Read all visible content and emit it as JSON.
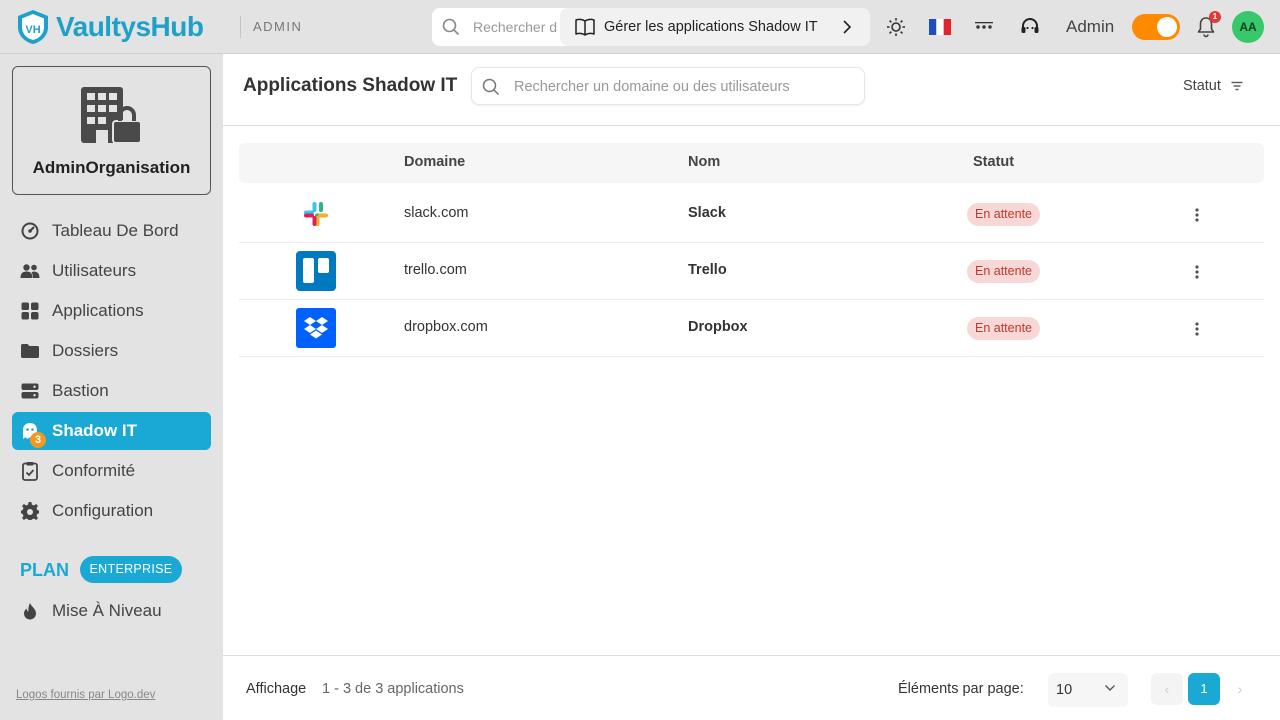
{
  "header": {
    "brand": "VaultysHub",
    "section": "ADMIN",
    "search_placeholder": "Rechercher d",
    "guide_label": "Gérer les applications Shadow IT",
    "user_name": "Admin",
    "notifications_count": "1",
    "avatar_initials": "AA",
    "language_flag": "🇫🇷",
    "accent_color": "#1aa8d4",
    "toggle_color": "#ff8a00"
  },
  "sidebar": {
    "org_name": "AdminOrganisation",
    "items": [
      {
        "label": "Tableau De Bord",
        "icon": "dashboard-icon"
      },
      {
        "label": "Utilisateurs",
        "icon": "users-icon"
      },
      {
        "label": "Applications",
        "icon": "apps-grid-icon"
      },
      {
        "label": "Dossiers",
        "icon": "folder-icon"
      },
      {
        "label": "Bastion",
        "icon": "server-icon"
      },
      {
        "label": "Shadow IT",
        "icon": "ghost-icon",
        "badge": "3",
        "active": true
      },
      {
        "label": "Conformité",
        "icon": "clipboard-check-icon"
      },
      {
        "label": "Configuration",
        "icon": "gear-icon"
      }
    ],
    "plan_label": "PLAN",
    "plan_badge": "ENTERPRISE",
    "upgrade_label": "Mise À Niveau",
    "logos_credit": "Logos fournis par Logo.dev"
  },
  "main": {
    "title": "Applications Shadow IT",
    "search_placeholder": "Rechercher un domaine ou des utilisateurs",
    "status_filter": "Statut",
    "columns": [
      "Domaine",
      "Nom",
      "Statut"
    ],
    "rows": [
      {
        "domain": "slack.com",
        "name": "Slack",
        "status": "En attente",
        "logo": "slack-logo"
      },
      {
        "domain": "trello.com",
        "name": "Trello",
        "status": "En attente",
        "logo": "trello-logo"
      },
      {
        "domain": "dropbox.com",
        "name": "Dropbox",
        "status": "En attente",
        "logo": "dropbox-logo"
      }
    ],
    "footer": {
      "display_label": "Affichage",
      "display_range": "1 - 3 de 3  applications",
      "per_page_label": "Éléments par page:",
      "per_page_value": "10",
      "current_page": "1"
    }
  }
}
